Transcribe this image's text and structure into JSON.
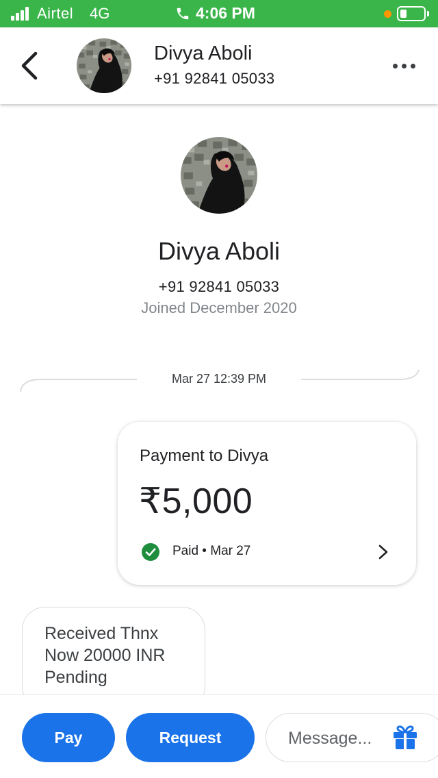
{
  "status_bar": {
    "carrier": "Airtel",
    "network": "4G",
    "time": "4:06 PM",
    "icons": [
      "signal-icon",
      "phone-icon",
      "orange-dot-icon",
      "battery-icon"
    ]
  },
  "header": {
    "contact_name": "Divya Aboli",
    "contact_phone": "+91 92841 05033",
    "icons": [
      "back-arrow-icon",
      "avatar",
      "more-options-icon"
    ]
  },
  "profile": {
    "name": "Divya Aboli",
    "phone": "+91 92841 05033",
    "joined": "Joined December 2020"
  },
  "thread": {
    "timestamp": "Mar 27 12:39 PM",
    "payment": {
      "title": "Payment to Divya",
      "amount": "₹5,000",
      "status": "Paid • Mar 27",
      "icons": [
        "check-circle-icon",
        "chevron-right-icon"
      ]
    },
    "message": "Received Thnx\nNow 20000 INR\nPending"
  },
  "bottom_bar": {
    "pay_label": "Pay",
    "request_label": "Request",
    "message_placeholder": "Message...",
    "icons": [
      "gift-icon"
    ]
  },
  "colors": {
    "status_bar_bg": "#39b54a",
    "primary_button": "#1a73e8",
    "success_green": "#1e8e3e",
    "orange_dot": "#ff9500"
  }
}
